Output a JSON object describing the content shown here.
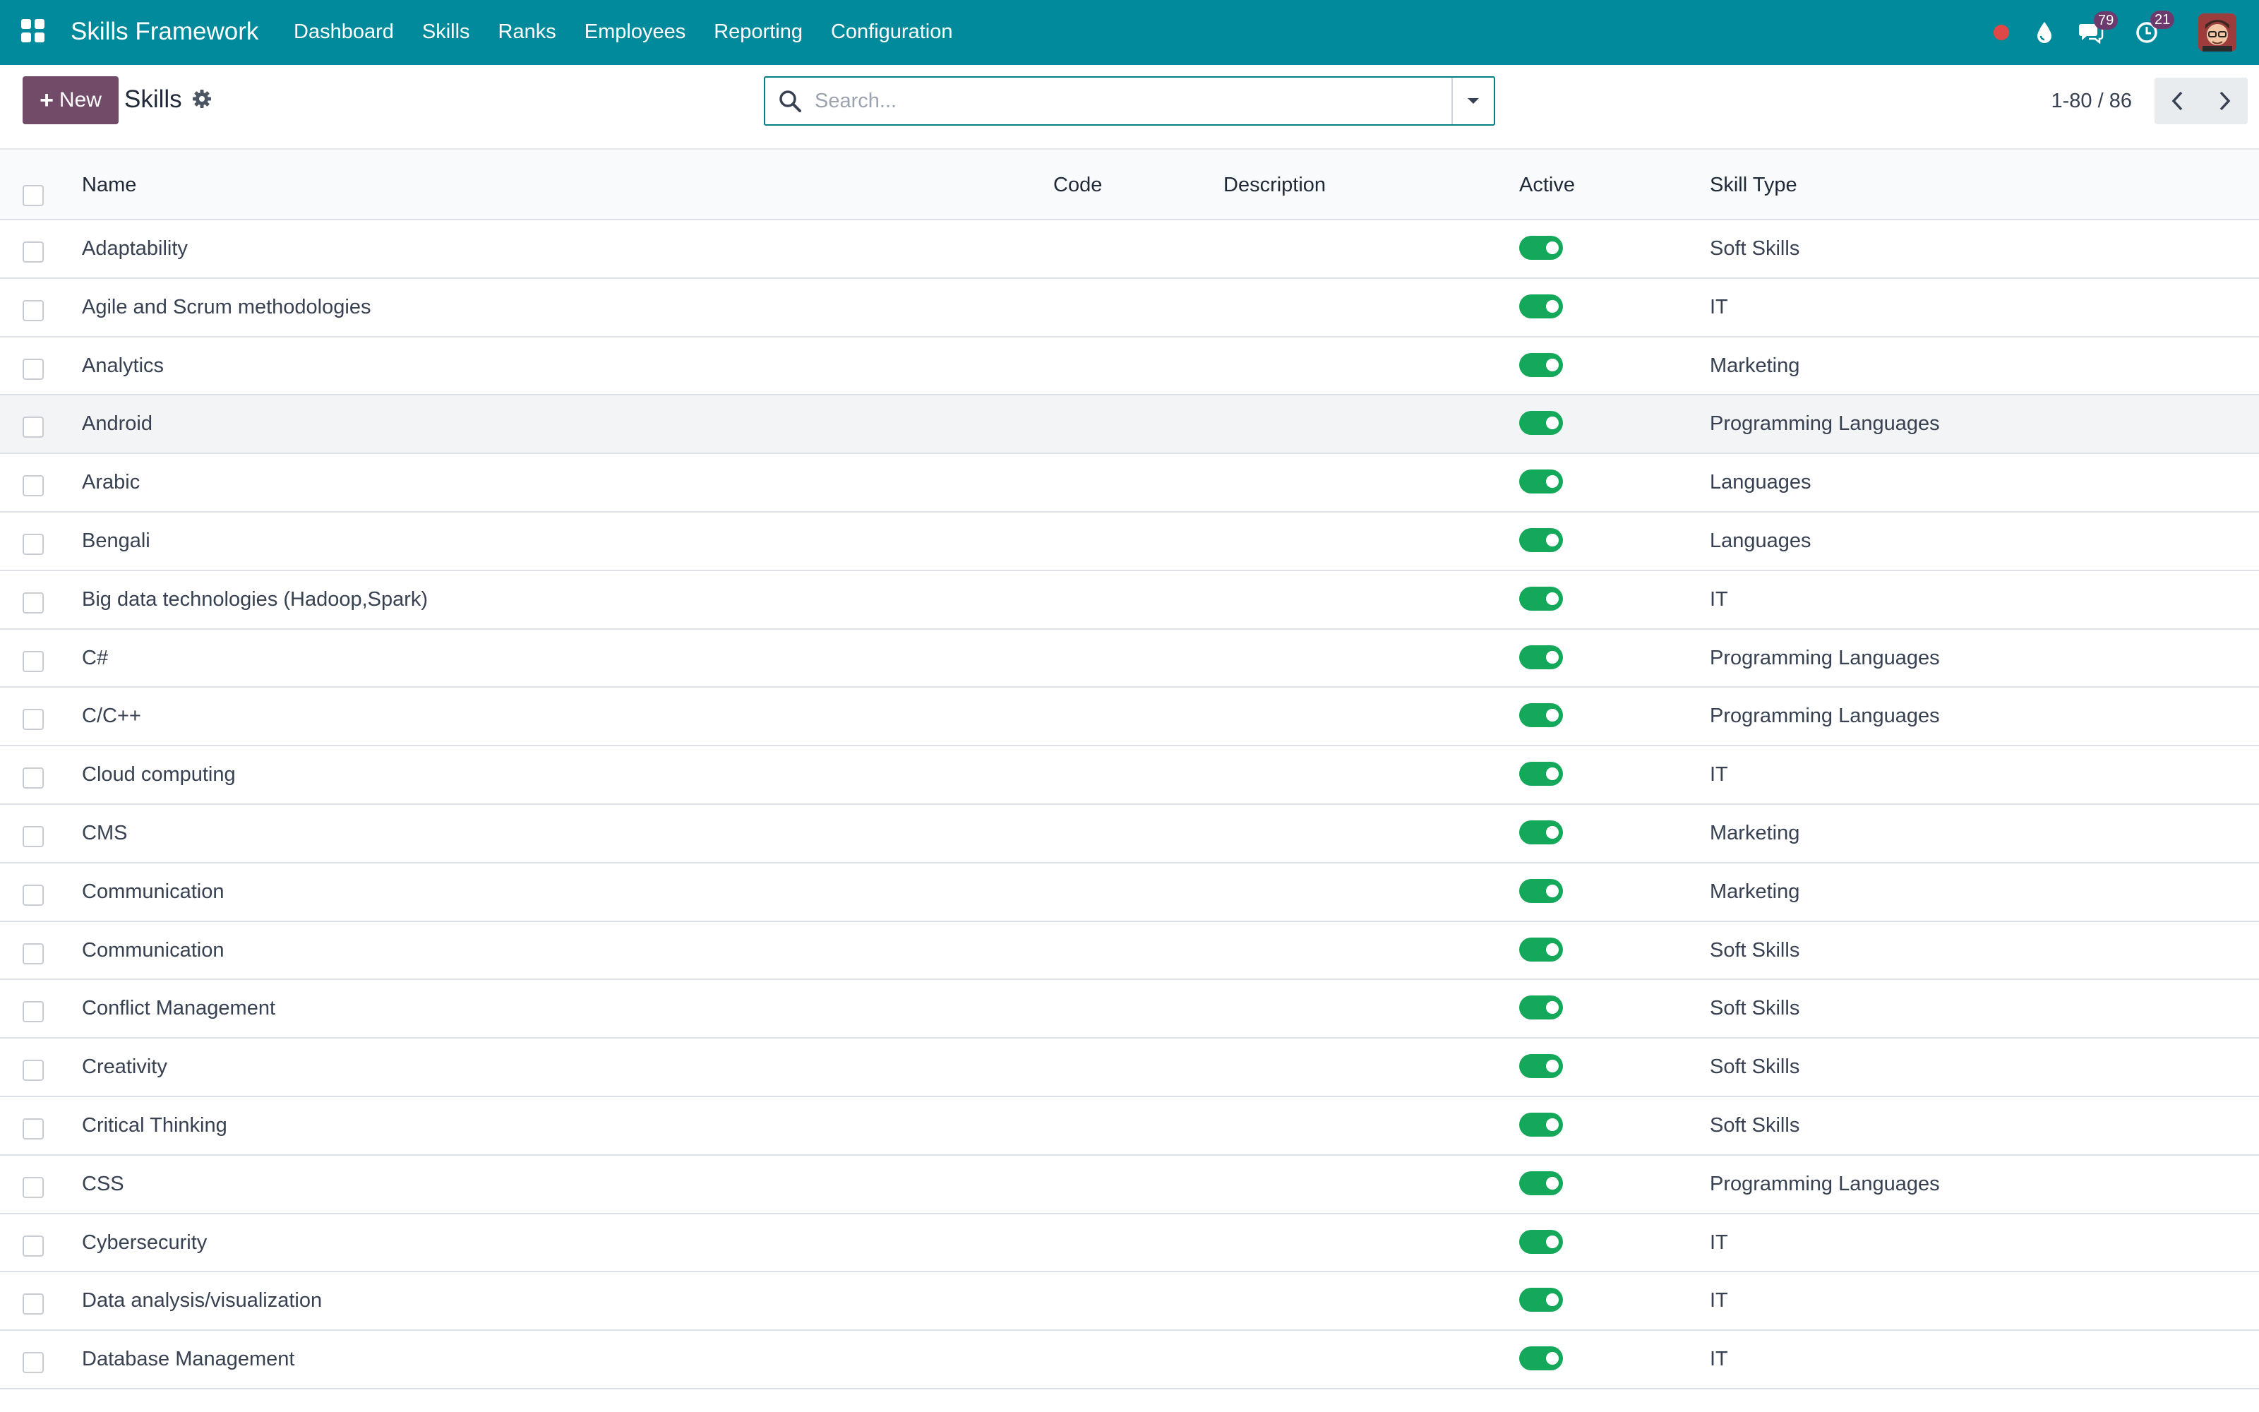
{
  "navbar": {
    "brand": "Skills Framework",
    "menu": [
      "Dashboard",
      "Skills",
      "Ranks",
      "Employees",
      "Reporting",
      "Configuration"
    ],
    "messages_count": "79",
    "activities_count": "21",
    "colors": {
      "bar": "#018a9c",
      "badge": "#6d3a6d",
      "record": "#e04848"
    }
  },
  "control_panel": {
    "new_label": "New",
    "title": "Skills",
    "search_placeholder": "Search...",
    "pager": "1-80 / 86"
  },
  "table": {
    "columns": {
      "name": "Name",
      "code": "Code",
      "description": "Description",
      "active": "Active",
      "skill_type": "Skill Type"
    },
    "rows": [
      {
        "name": "Adaptability",
        "code": "",
        "description": "",
        "active": true,
        "skill_type": "Soft Skills"
      },
      {
        "name": "Agile and Scrum methodologies",
        "code": "",
        "description": "",
        "active": true,
        "skill_type": "IT"
      },
      {
        "name": "Analytics",
        "code": "",
        "description": "",
        "active": true,
        "skill_type": "Marketing"
      },
      {
        "name": "Android",
        "code": "",
        "description": "",
        "active": true,
        "skill_type": "Programming Languages"
      },
      {
        "name": "Arabic",
        "code": "",
        "description": "",
        "active": true,
        "skill_type": "Languages"
      },
      {
        "name": "Bengali",
        "code": "",
        "description": "",
        "active": true,
        "skill_type": "Languages"
      },
      {
        "name": "Big data technologies (Hadoop,Spark)",
        "code": "",
        "description": "",
        "active": true,
        "skill_type": "IT"
      },
      {
        "name": "C#",
        "code": "",
        "description": "",
        "active": true,
        "skill_type": "Programming Languages"
      },
      {
        "name": "C/C++",
        "code": "",
        "description": "",
        "active": true,
        "skill_type": "Programming Languages"
      },
      {
        "name": "Cloud computing",
        "code": "",
        "description": "",
        "active": true,
        "skill_type": "IT"
      },
      {
        "name": "CMS",
        "code": "",
        "description": "",
        "active": true,
        "skill_type": "Marketing"
      },
      {
        "name": "Communication",
        "code": "",
        "description": "",
        "active": true,
        "skill_type": "Marketing"
      },
      {
        "name": "Communication",
        "code": "",
        "description": "",
        "active": true,
        "skill_type": "Soft Skills"
      },
      {
        "name": "Conflict Management",
        "code": "",
        "description": "",
        "active": true,
        "skill_type": "Soft Skills"
      },
      {
        "name": "Creativity",
        "code": "",
        "description": "",
        "active": true,
        "skill_type": "Soft Skills"
      },
      {
        "name": "Critical Thinking",
        "code": "",
        "description": "",
        "active": true,
        "skill_type": "Soft Skills"
      },
      {
        "name": "CSS",
        "code": "",
        "description": "",
        "active": true,
        "skill_type": "Programming Languages"
      },
      {
        "name": "Cybersecurity",
        "code": "",
        "description": "",
        "active": true,
        "skill_type": "IT"
      },
      {
        "name": "Data analysis/visualization",
        "code": "",
        "description": "",
        "active": true,
        "skill_type": "IT"
      },
      {
        "name": "Database Management",
        "code": "",
        "description": "",
        "active": true,
        "skill_type": "IT"
      }
    ],
    "hovered_row": "Android",
    "active_color": "#14a85a"
  }
}
